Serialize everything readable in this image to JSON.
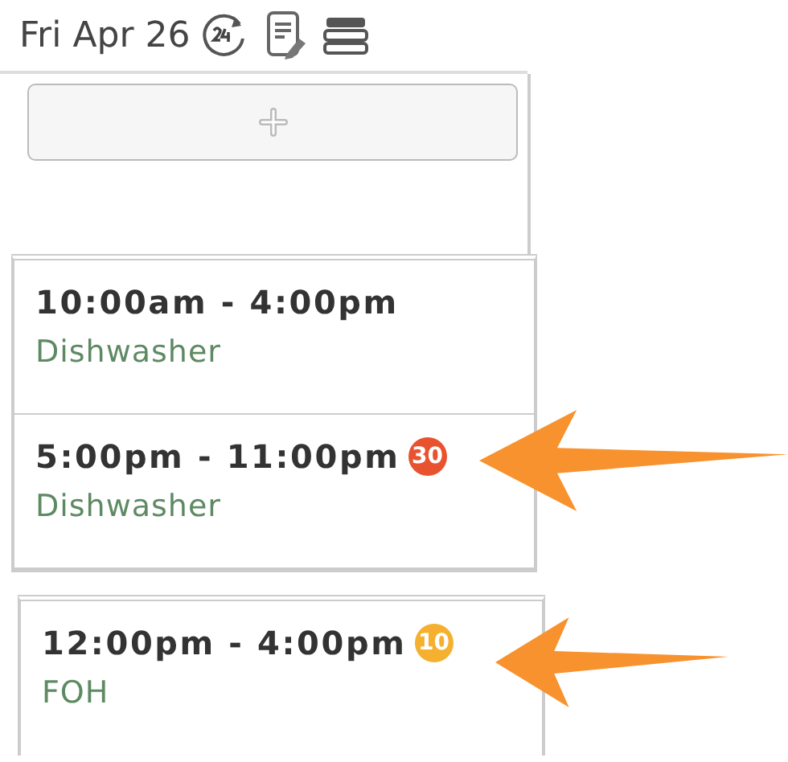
{
  "header": {
    "date": "Fri Apr 26"
  },
  "groups": [
    {
      "shifts": [
        {
          "time": "10:00am - 4:00pm",
          "role": "Dishwasher"
        },
        {
          "time": "5:00pm - 11:00pm",
          "role": "Dishwasher",
          "badge": {
            "text": "30",
            "color": "#e8522f"
          }
        }
      ]
    },
    {
      "shifts": [
        {
          "time": "12:00pm - 4:00pm",
          "role": "FOH",
          "badge": {
            "text": "10",
            "color": "#f4b02e"
          }
        }
      ]
    }
  ]
}
